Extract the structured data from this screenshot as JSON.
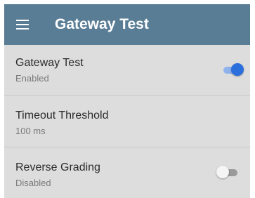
{
  "appbar": {
    "title": "Gateway Test",
    "menu_icon": "hamburger-menu-icon",
    "background_color": "#5a7d96"
  },
  "settings": [
    {
      "title": "Gateway Test",
      "value": "Enabled",
      "toggle": true
    },
    {
      "title": "Timeout Threshold",
      "value": "100 ms"
    },
    {
      "title": "Reverse Grading",
      "value": "Disabled",
      "toggle": false
    }
  ],
  "colors": {
    "list_background": "#dddddd",
    "toggle_on": "#2a6fdc",
    "toggle_off": "#f5f5f5"
  }
}
